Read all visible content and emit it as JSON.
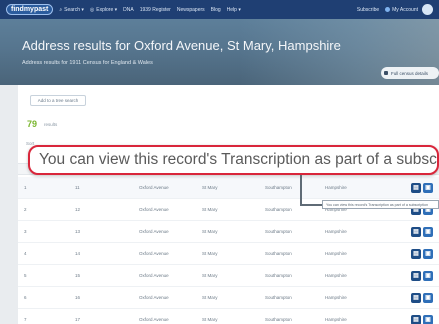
{
  "nav": {
    "logo": "findmypast",
    "items": [
      {
        "label": "Search ▾",
        "icon": "search-icon"
      },
      {
        "label": "Explore ▾",
        "icon": "explore-icon"
      },
      {
        "label": "DNA"
      },
      {
        "label": "1939 Register"
      },
      {
        "label": "Newspapers"
      },
      {
        "label": "Blog"
      },
      {
        "label": "Help ▾"
      }
    ],
    "subscribe_label": "Subscribe",
    "account_label": "My Account"
  },
  "header": {
    "title": "Address results for Oxford Avenue, St Mary, Hampshire",
    "subtitle": "Address results for 1911 Census for England & Wales",
    "button_label": "Full census details"
  },
  "results": {
    "add_button": "Add to a tree search",
    "count": "79",
    "count_label": "results",
    "sort_label": "Sort"
  },
  "table": {
    "rows": [
      {
        "schedule": "1",
        "num": "11",
        "street": "Oxford Avenue",
        "parish": "St Mary",
        "district": "Southampton",
        "county": "Hampshire"
      },
      {
        "schedule": "2",
        "num": "12",
        "street": "Oxford Avenue",
        "parish": "St Mary",
        "district": "Southampton",
        "county": "Hampshire"
      },
      {
        "schedule": "3",
        "num": "13",
        "street": "Oxford Avenue",
        "parish": "St Mary",
        "district": "Southampton",
        "county": "Hampshire"
      },
      {
        "schedule": "4",
        "num": "14",
        "street": "Oxford Avenue",
        "parish": "St Mary",
        "district": "Southampton",
        "county": "Hampshire"
      },
      {
        "schedule": "5",
        "num": "15",
        "street": "Oxford Avenue",
        "parish": "St Mary",
        "district": "Southampton",
        "county": "Hampshire"
      },
      {
        "schedule": "6",
        "num": "16",
        "street": "Oxford Avenue",
        "parish": "St Mary",
        "district": "Southampton",
        "county": "Hampshire"
      },
      {
        "schedule": "7",
        "num": "17",
        "street": "Oxford Avenue",
        "parish": "St Mary",
        "district": "Southampton",
        "county": "Hampshire"
      }
    ]
  },
  "callout": {
    "text": "You can view this record's Transcription as part of a subscription",
    "tooltip": "You can view this record's Transcription as part of a subscription"
  },
  "colors": {
    "nav_bg": "#1f3f73",
    "accent_green": "#7ab52e",
    "callout_border": "#d9263b",
    "action_blue": "#1e4d86"
  }
}
